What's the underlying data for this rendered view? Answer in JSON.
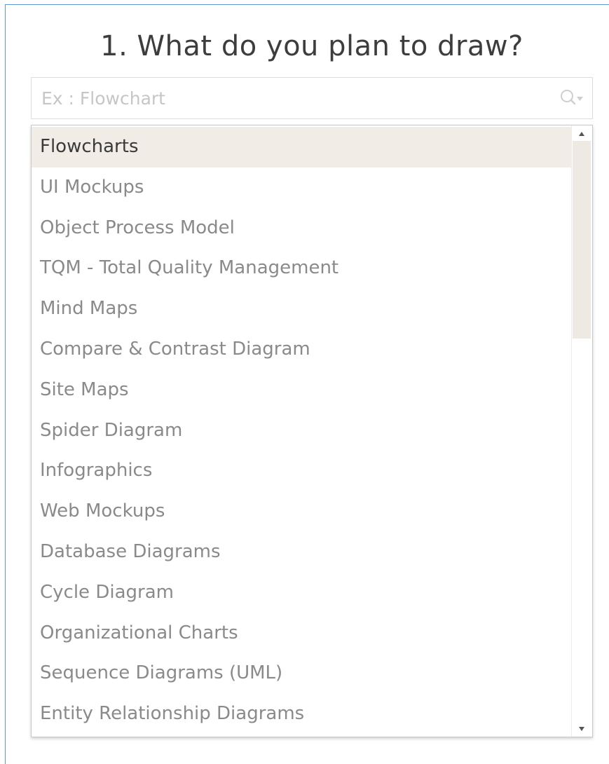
{
  "heading": "1. What do you plan to draw?",
  "search": {
    "placeholder": "Ex : Flowchart",
    "value": "",
    "icon": "search-icon"
  },
  "options": [
    {
      "label": "Flowcharts",
      "selected": true
    },
    {
      "label": "UI Mockups"
    },
    {
      "label": "Object Process Model"
    },
    {
      "label": "TQM - Total Quality Management"
    },
    {
      "label": "Mind Maps"
    },
    {
      "label": "Compare & Contrast Diagram"
    },
    {
      "label": "Site Maps"
    },
    {
      "label": "Spider Diagram"
    },
    {
      "label": "Infographics"
    },
    {
      "label": "Web Mockups"
    },
    {
      "label": "Database Diagrams"
    },
    {
      "label": "Cycle Diagram"
    },
    {
      "label": "Organizational Charts"
    },
    {
      "label": "Sequence Diagrams (UML)"
    },
    {
      "label": "Entity Relationship Diagrams"
    }
  ],
  "scroll": {
    "position_fraction": 0.0,
    "visible_fraction": 0.34
  },
  "colors": {
    "frame_border": "#5b9bd5",
    "selected_background": "#f1ece6",
    "text_muted": "#8a8a8a",
    "text_selected": "#3a3a3a"
  }
}
